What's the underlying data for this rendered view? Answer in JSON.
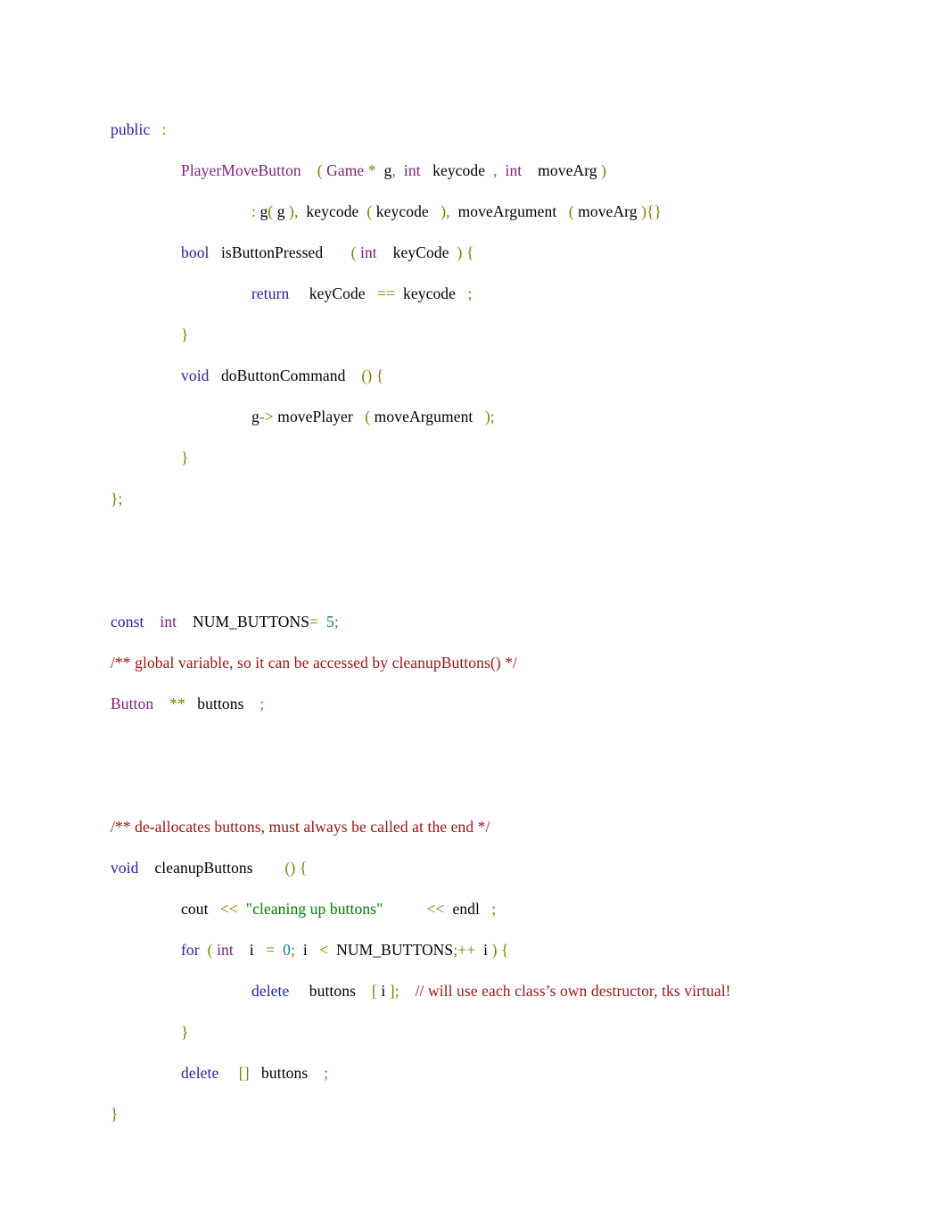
{
  "document": {
    "type": "code-listing",
    "language": "C++",
    "page_background": "#ffffff",
    "colors": {
      "keyword": "#2222aa",
      "type": "#7d1d7d",
      "punctuation": "#7f7f00",
      "identifier": "#000000",
      "comment": "#9e1313",
      "string": "#008000",
      "number": "#108080"
    }
  },
  "code": {
    "line_01": {
      "indent": 0,
      "tokens": [
        {
          "t": "public",
          "c": "kw"
        },
        {
          "t": "   ",
          "c": "id"
        },
        {
          "t": ":",
          "c": "pn"
        }
      ]
    },
    "line_02": {
      "indent": 1,
      "tokens": [
        {
          "t": "PlayerMoveButton",
          "c": "ty"
        },
        {
          "t": "    ",
          "c": "id"
        },
        {
          "t": "(",
          "c": "pn"
        },
        {
          "t": " ",
          "c": "id"
        },
        {
          "t": "Game",
          "c": "ty"
        },
        {
          "t": " ",
          "c": "id"
        },
        {
          "t": "*",
          "c": "pn"
        },
        {
          "t": "  g",
          "c": "id"
        },
        {
          "t": ",",
          "c": "pn"
        },
        {
          "t": "  ",
          "c": "id"
        },
        {
          "t": "int",
          "c": "ty"
        },
        {
          "t": "   keycode",
          "c": "id"
        },
        {
          "t": "  ",
          "c": "id"
        },
        {
          "t": ",",
          "c": "pn"
        },
        {
          "t": "  ",
          "c": "id"
        },
        {
          "t": "int",
          "c": "ty"
        },
        {
          "t": "    moveArg ",
          "c": "id"
        },
        {
          "t": ")",
          "c": "pn"
        }
      ]
    },
    "line_03": {
      "indent": 2,
      "tokens": [
        {
          "t": ":",
          "c": "pn"
        },
        {
          "t": " g",
          "c": "id"
        },
        {
          "t": "(",
          "c": "pn"
        },
        {
          "t": " g ",
          "c": "id"
        },
        {
          "t": ")",
          "c": "pn"
        },
        {
          "t": ",",
          "c": "pn"
        },
        {
          "t": "  keycode ",
          "c": "id"
        },
        {
          "t": " (",
          "c": "pn"
        },
        {
          "t": " keycode   ",
          "c": "id"
        },
        {
          "t": ")",
          "c": "pn"
        },
        {
          "t": ",",
          "c": "pn"
        },
        {
          "t": "  moveArgument ",
          "c": "id"
        },
        {
          "t": "  (",
          "c": "pn"
        },
        {
          "t": " moveArg ",
          "c": "id"
        },
        {
          "t": "){}",
          "c": "pn"
        }
      ]
    },
    "line_04": {
      "indent": 1,
      "tokens": [
        {
          "t": "bool",
          "c": "kw"
        },
        {
          "t": "   isButtonPressed",
          "c": "id"
        },
        {
          "t": "       ",
          "c": "id"
        },
        {
          "t": "(",
          "c": "pn"
        },
        {
          "t": " ",
          "c": "id"
        },
        {
          "t": "int",
          "c": "ty"
        },
        {
          "t": "    keyCode ",
          "c": "id"
        },
        {
          "t": " )",
          "c": "pn"
        },
        {
          "t": " ",
          "c": "id"
        },
        {
          "t": "{",
          "c": "pn"
        }
      ]
    },
    "line_05": {
      "indent": 2,
      "tokens": [
        {
          "t": "return",
          "c": "kw"
        },
        {
          "t": "     keyCode ",
          "c": "id"
        },
        {
          "t": "  ",
          "c": "id"
        },
        {
          "t": "==",
          "c": "pn"
        },
        {
          "t": "  keycode ",
          "c": "id"
        },
        {
          "t": "  ;",
          "c": "pn"
        }
      ]
    },
    "line_06": {
      "indent": 1,
      "tokens": [
        {
          "t": "}",
          "c": "pn"
        }
      ]
    },
    "line_07": {
      "indent": 1,
      "tokens": [
        {
          "t": "void",
          "c": "kw"
        },
        {
          "t": "   doButtonCommand",
          "c": "id"
        },
        {
          "t": "    ",
          "c": "id"
        },
        {
          "t": "()",
          "c": "pn"
        },
        {
          "t": " ",
          "c": "id"
        },
        {
          "t": "{",
          "c": "pn"
        }
      ]
    },
    "line_08": {
      "indent": 2,
      "tokens": [
        {
          "t": "g",
          "c": "id"
        },
        {
          "t": "->",
          "c": "pn"
        },
        {
          "t": " movePlayer ",
          "c": "id"
        },
        {
          "t": "  (",
          "c": "pn"
        },
        {
          "t": " moveArgument ",
          "c": "id"
        },
        {
          "t": "  );",
          "c": "pn"
        }
      ]
    },
    "line_09": {
      "indent": 1,
      "tokens": [
        {
          "t": "}",
          "c": "pn"
        }
      ]
    },
    "line_10": {
      "indent": 0,
      "tokens": [
        {
          "t": "};",
          "c": "pn"
        }
      ]
    },
    "line_11": {
      "indent": 0,
      "tokens": [
        {
          "t": "const",
          "c": "kw"
        },
        {
          "t": "    ",
          "c": "id"
        },
        {
          "t": "int",
          "c": "ty"
        },
        {
          "t": "    NUM_BUTTONS",
          "c": "id"
        },
        {
          "t": "=",
          "c": "pn"
        },
        {
          "t": "  ",
          "c": "id"
        },
        {
          "t": "5",
          "c": "nu"
        },
        {
          "t": ";",
          "c": "pn"
        }
      ]
    },
    "line_12": {
      "indent": 0,
      "tokens": [
        {
          "t": "/** global variable, so it can be accessed by cleanupButtons() */",
          "c": "cm"
        }
      ]
    },
    "line_13": {
      "indent": 0,
      "tokens": [
        {
          "t": "Button",
          "c": "ty"
        },
        {
          "t": "    ",
          "c": "id"
        },
        {
          "t": "**",
          "c": "pn"
        },
        {
          "t": "   buttons ",
          "c": "id"
        },
        {
          "t": "   ;",
          "c": "pn"
        }
      ]
    },
    "line_14": {
      "indent": 0,
      "tokens": [
        {
          "t": "/** de-allocates buttons, must always be called at the end */",
          "c": "cm"
        }
      ]
    },
    "line_15": {
      "indent": 0,
      "tokens": [
        {
          "t": "void",
          "c": "kw"
        },
        {
          "t": "    cleanupButtons",
          "c": "id"
        },
        {
          "t": "        ",
          "c": "id"
        },
        {
          "t": "()",
          "c": "pn"
        },
        {
          "t": " ",
          "c": "id"
        },
        {
          "t": "{",
          "c": "pn"
        }
      ]
    },
    "line_16": {
      "indent": 1,
      "tokens": [
        {
          "t": "cout ",
          "c": "id"
        },
        {
          "t": "  ",
          "c": "id"
        },
        {
          "t": "<<",
          "c": "pn"
        },
        {
          "t": "  ",
          "c": "id"
        },
        {
          "t": "\"cleaning up buttons\"",
          "c": "st"
        },
        {
          "t": "           ",
          "c": "id"
        },
        {
          "t": "<<",
          "c": "pn"
        },
        {
          "t": "  endl ",
          "c": "id"
        },
        {
          "t": "  ;",
          "c": "pn"
        }
      ]
    },
    "line_17": {
      "indent": 1,
      "tokens": [
        {
          "t": "for",
          "c": "kw"
        },
        {
          "t": "  ",
          "c": "id"
        },
        {
          "t": "(",
          "c": "pn"
        },
        {
          "t": " ",
          "c": "id"
        },
        {
          "t": "int",
          "c": "ty"
        },
        {
          "t": "    i ",
          "c": "id"
        },
        {
          "t": "  =",
          "c": "pn"
        },
        {
          "t": "  ",
          "c": "id"
        },
        {
          "t": "0",
          "c": "nu"
        },
        {
          "t": ";",
          "c": "pn"
        },
        {
          "t": "  i ",
          "c": "id"
        },
        {
          "t": "  <",
          "c": "pn"
        },
        {
          "t": "  NUM_BUTTONS",
          "c": "id"
        },
        {
          "t": ";",
          "c": "pn"
        },
        {
          "t": "++",
          "c": "pn"
        },
        {
          "t": "  i ",
          "c": "id"
        },
        {
          "t": ")",
          "c": "pn"
        },
        {
          "t": " ",
          "c": "id"
        },
        {
          "t": "{",
          "c": "pn"
        }
      ]
    },
    "line_18": {
      "indent": 2,
      "tokens": [
        {
          "t": "delete",
          "c": "kw"
        },
        {
          "t": "     buttons ",
          "c": "id"
        },
        {
          "t": "   [",
          "c": "pn"
        },
        {
          "t": " i ",
          "c": "id"
        },
        {
          "t": "];",
          "c": "pn"
        },
        {
          "t": "    ",
          "c": "id"
        },
        {
          "t": "// will use each class’s own destructor, tks virtual!",
          "c": "cm"
        }
      ]
    },
    "line_19": {
      "indent": 1,
      "tokens": [
        {
          "t": "}",
          "c": "pn"
        }
      ]
    },
    "line_20": {
      "indent": 1,
      "tokens": [
        {
          "t": "delete",
          "c": "kw"
        },
        {
          "t": "     ",
          "c": "id"
        },
        {
          "t": "[]",
          "c": "pn"
        },
        {
          "t": "   buttons ",
          "c": "id"
        },
        {
          "t": "   ;",
          "c": "pn"
        }
      ]
    },
    "line_21": {
      "indent": 0,
      "tokens": [
        {
          "t": "}",
          "c": "pn"
        }
      ]
    }
  },
  "plain_text": {
    "line_01": "public   :",
    "line_02": "PlayerMoveButton    ( Game *  g,  int   keycode  ,  int    moveArg )",
    "line_03": ": g( g ),  keycode  ( keycode   ),  moveArgument   ( moveArg ){}",
    "line_04": "bool   isButtonPressed       ( int    keyCode  ) {",
    "line_05": "return     keyCode   ==  keycode   ;",
    "line_06": "}",
    "line_07": "void   doButtonCommand    () {",
    "line_08": "g-> movePlayer   ( moveArgument   );",
    "line_09": "}",
    "line_10": "};",
    "line_11": "const    int    NUM_BUTTONS=  5;",
    "line_12": "/** global variable, so it can be accessed by cleanupButtons() */",
    "line_13": "Button    **   buttons    ;",
    "line_14": "/** de-allocates buttons, must always be called at the end */",
    "line_15": "void    cleanupButtons        () {",
    "line_16": "cout   <<  \"cleaning up buttons\"           <<  endl   ;",
    "line_17": "for  ( int    i   =  0;  i   <  NUM_BUTTONS;++  i ) {",
    "line_18": "delete     buttons    [ i ];    // will use each class’s own destructor, tks virtual!",
    "line_19": "}",
    "line_20": "delete     []   buttons    ;",
    "line_21": "}"
  }
}
